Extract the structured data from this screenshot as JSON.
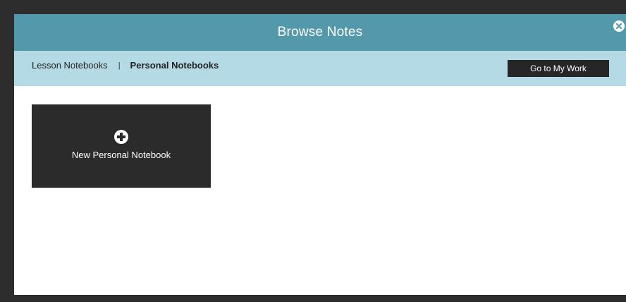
{
  "dialog": {
    "title": "Browse Notes",
    "close_icon": "close-circle-icon"
  },
  "tabs": [
    {
      "label": "Lesson Notebooks",
      "active": false
    },
    {
      "label": "Personal Notebooks",
      "active": true
    }
  ],
  "tab_separator": "|",
  "go_to_my_work_label": "Go to My Work",
  "new_notebook": {
    "icon": "plus-circle-icon",
    "label": "New Personal Notebook"
  },
  "colors": {
    "title_bar": "#5499ab",
    "tab_bar": "#b4dae6",
    "dark": "#2b2b2b"
  }
}
